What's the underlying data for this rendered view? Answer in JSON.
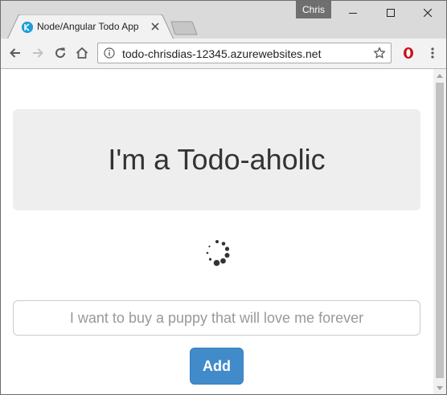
{
  "browser": {
    "profile_name": "Chris",
    "tab": {
      "title": "Node/Angular Todo App",
      "favicon": "app-favicon-icon"
    },
    "address_bar": {
      "url": "todo-chrisdias-12345.azurewebsites.net"
    },
    "icons": {
      "back": "back-arrow-icon",
      "forward": "forward-arrow-icon",
      "reload": "reload-icon",
      "home": "home-icon",
      "info": "info-icon",
      "bookmark": "star-icon",
      "extension": "opera-extension-icon",
      "menu": "kebab-menu-icon"
    }
  },
  "page": {
    "heading": "I'm a Todo-aholic",
    "loading": true,
    "todo_input": {
      "value": "",
      "placeholder": "I want to buy a puppy that will love me forever"
    },
    "add_button_label": "Add"
  },
  "colors": {
    "primary_button": "#428bca",
    "jumbotron_bg": "#eeeeee",
    "titlebar_bg": "#dadada",
    "toolbar_bg": "#f2f2f2",
    "extension_red": "#cc0f16"
  }
}
